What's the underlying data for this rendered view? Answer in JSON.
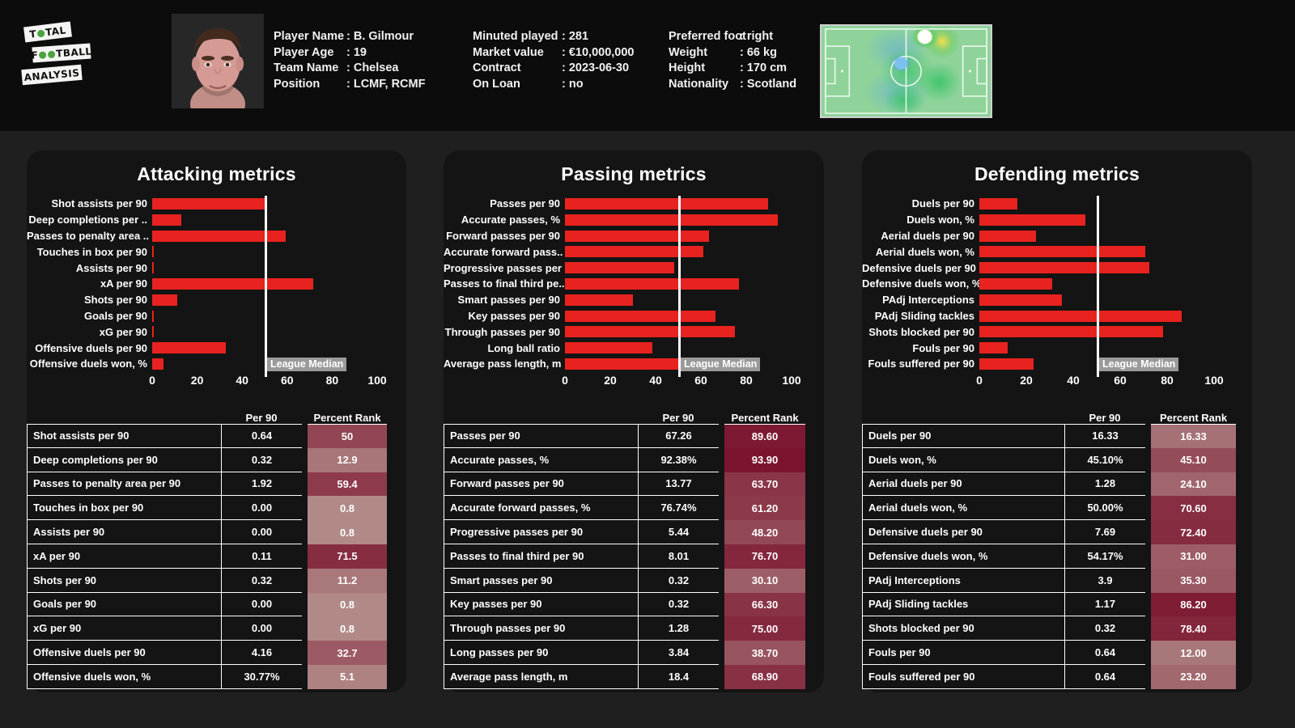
{
  "brand": {
    "line1": "TOTAL",
    "line2": "FOOTBALL",
    "line3": "ANALYSIS",
    "ball_icon": "football-icon"
  },
  "header": {
    "photo_alt": "player-portrait",
    "heatmap_alt": "pitch-heatmap",
    "info_columns": [
      {
        "name": "identity",
        "rows": [
          {
            "key": "Player Name",
            "value": ": B. Gilmour"
          },
          {
            "key": "Player Age",
            "value": ": 19"
          },
          {
            "key": "Team Name",
            "value": ": Chelsea"
          },
          {
            "key": "Position",
            "value": ": LCMF, RCMF"
          }
        ]
      },
      {
        "name": "contract",
        "rows": [
          {
            "key": "Minuted played",
            "value": ": 281"
          },
          {
            "key": "Market value",
            "value": ": €10,000,000"
          },
          {
            "key": "Contract",
            "value": ": 2023-06-30"
          },
          {
            "key": "On Loan",
            "value": ": no"
          }
        ]
      },
      {
        "name": "physical",
        "rows": [
          {
            "key": "Preferred foot",
            "value": ": right"
          },
          {
            "key": "Weight",
            "value": ": 66 kg"
          },
          {
            "key": "Height",
            "value": ": 170 cm"
          },
          {
            "key": "Nationality",
            "value": ": Scotland"
          }
        ]
      }
    ]
  },
  "colors": {
    "bar_red": "#e8221f",
    "median_line": "#ffffff",
    "median_tag_bg": "#9a9a9a",
    "panel_bg": "#141414",
    "page_bg": "#1f1f1f",
    "header_bg": "#0c0c0c"
  },
  "table_headers": {
    "per90": "Per 90",
    "rank": "Percent Rank"
  },
  "median_label": "League Median",
  "chart_data": [
    {
      "type": "bar",
      "title": "Attacking metrics",
      "orientation": "horizontal",
      "xlabel": "",
      "ylabel": "",
      "xlim": [
        0,
        100
      ],
      "xticks": [
        0,
        20,
        40,
        60,
        80,
        100
      ],
      "grid": false,
      "legend": "none",
      "median_value": 50,
      "categories": [
        "Shot assists per 90",
        "Deep completions per ..",
        "Passes to penalty area ..",
        "Touches in box per 90",
        "Assists per 90",
        "xA per 90",
        "Shots per 90",
        "Goals per 90",
        "xG per 90",
        "Offensive duels per 90",
        "Offensive duels won, %"
      ],
      "values": [
        50,
        12.9,
        59.4,
        0.8,
        0.8,
        71.5,
        11.2,
        0.8,
        0.8,
        32.7,
        5.1
      ]
    },
    {
      "type": "bar",
      "title": "Passing metrics",
      "orientation": "horizontal",
      "xlabel": "",
      "ylabel": "",
      "xlim": [
        0,
        100
      ],
      "xticks": [
        0,
        20,
        40,
        60,
        80,
        100
      ],
      "grid": false,
      "legend": "none",
      "median_value": 50,
      "categories": [
        "Passes per 90",
        "Accurate passes, %",
        "Forward passes per 90",
        "Accurate forward pass..",
        "Progressive passes per ..",
        "Passes to final third pe..",
        "Smart passes per 90",
        "Key passes per 90",
        "Through passes per 90",
        "Long ball ratio",
        "Average pass length, m"
      ],
      "values": [
        89.6,
        93.9,
        63.7,
        61.2,
        48.2,
        76.7,
        30.1,
        66.3,
        75.0,
        38.7,
        68.9
      ]
    },
    {
      "type": "bar",
      "title": "Defending metrics",
      "orientation": "horizontal",
      "xlabel": "",
      "ylabel": "",
      "xlim": [
        0,
        100
      ],
      "xticks": [
        0,
        20,
        40,
        60,
        80,
        100
      ],
      "grid": false,
      "legend": "none",
      "median_value": 50,
      "categories": [
        "Duels per 90",
        "Duels won, %",
        "Aerial duels per 90",
        "Aerial duels won, %",
        "Defensive duels per 90",
        "Defensive duels won, %",
        "PAdj Interceptions",
        "PAdj Sliding tackles",
        "Shots blocked per 90",
        "Fouls per 90",
        "Fouls suffered per 90"
      ],
      "values": [
        16.33,
        45.1,
        24.1,
        70.6,
        72.4,
        31.0,
        35.3,
        86.2,
        78.4,
        12.0,
        23.2
      ]
    }
  ],
  "tables": [
    {
      "name": "attacking-table",
      "rows": [
        {
          "metric": "Shot assists per 90",
          "per90": "0.64",
          "rank": "50",
          "rank_value": 50
        },
        {
          "metric": "Deep completions per 90",
          "per90": "0.32",
          "rank": "12.9",
          "rank_value": 12.9
        },
        {
          "metric": "Passes to penalty area per 90",
          "per90": "1.92",
          "rank": "59.4",
          "rank_value": 59.4
        },
        {
          "metric": "Touches in box per 90",
          "per90": "0.00",
          "rank": "0.8",
          "rank_value": 0.8
        },
        {
          "metric": "Assists per 90",
          "per90": "0.00",
          "rank": "0.8",
          "rank_value": 0.8
        },
        {
          "metric": "xA per 90",
          "per90": "0.11",
          "rank": "71.5",
          "rank_value": 71.5
        },
        {
          "metric": "Shots per 90",
          "per90": "0.32",
          "rank": "11.2",
          "rank_value": 11.2
        },
        {
          "metric": "Goals per 90",
          "per90": "0.00",
          "rank": "0.8",
          "rank_value": 0.8
        },
        {
          "metric": "xG per 90",
          "per90": "0.00",
          "rank": "0.8",
          "rank_value": 0.8
        },
        {
          "metric": "Offensive duels per 90",
          "per90": "4.16",
          "rank": "32.7",
          "rank_value": 32.7
        },
        {
          "metric": "Offensive duels won, %",
          "per90": "30.77%",
          "rank": "5.1",
          "rank_value": 5.1
        }
      ]
    },
    {
      "name": "passing-table",
      "rows": [
        {
          "metric": "Passes per 90",
          "per90": "67.26",
          "rank": "89.60",
          "rank_value": 89.6
        },
        {
          "metric": "Accurate passes, %",
          "per90": "92.38%",
          "rank": "93.90",
          "rank_value": 93.9
        },
        {
          "metric": "Forward passes per 90",
          "per90": "13.77",
          "rank": "63.70",
          "rank_value": 63.7
        },
        {
          "metric": "Accurate forward passes, %",
          "per90": "76.74%",
          "rank": "61.20",
          "rank_value": 61.2
        },
        {
          "metric": "Progressive passes per 90",
          "per90": "5.44",
          "rank": "48.20",
          "rank_value": 48.2
        },
        {
          "metric": "Passes to final third per 90",
          "per90": "8.01",
          "rank": "76.70",
          "rank_value": 76.7
        },
        {
          "metric": "Smart passes per 90",
          "per90": "0.32",
          "rank": "30.10",
          "rank_value": 30.1
        },
        {
          "metric": "Key passes per 90",
          "per90": "0.32",
          "rank": "66.30",
          "rank_value": 66.3
        },
        {
          "metric": "Through passes per 90",
          "per90": "1.28",
          "rank": "75.00",
          "rank_value": 75.0
        },
        {
          "metric": "Long passes per 90",
          "per90": "3.84",
          "rank": "38.70",
          "rank_value": 38.7
        },
        {
          "metric": "Average pass length, m",
          "per90": "18.4",
          "rank": "68.90",
          "rank_value": 68.9
        }
      ]
    },
    {
      "name": "defending-table",
      "rows": [
        {
          "metric": "Duels per 90",
          "per90": "16.33",
          "rank": "16.33",
          "rank_value": 16.33
        },
        {
          "metric": "Duels won, %",
          "per90": "45.10%",
          "rank": "45.10",
          "rank_value": 45.1
        },
        {
          "metric": "Aerial duels per 90",
          "per90": "1.28",
          "rank": "24.10",
          "rank_value": 24.1
        },
        {
          "metric": "Aerial duels won, %",
          "per90": "50.00%",
          "rank": "70.60",
          "rank_value": 70.6
        },
        {
          "metric": "Defensive duels per 90",
          "per90": "7.69",
          "rank": "72.40",
          "rank_value": 72.4
        },
        {
          "metric": "Defensive duels won, %",
          "per90": "54.17%",
          "rank": "31.00",
          "rank_value": 31.0
        },
        {
          "metric": "PAdj Interceptions",
          "per90": "3.9",
          "rank": "35.30",
          "rank_value": 35.3
        },
        {
          "metric": "PAdj Sliding tackles",
          "per90": "1.17",
          "rank": "86.20",
          "rank_value": 86.2
        },
        {
          "metric": "Shots blocked per 90",
          "per90": "0.32",
          "rank": "78.40",
          "rank_value": 78.4
        },
        {
          "metric": "Fouls per 90",
          "per90": "0.64",
          "rank": "12.00",
          "rank_value": 12.0
        },
        {
          "metric": "Fouls suffered per 90",
          "per90": "0.64",
          "rank": "23.20",
          "rank_value": 23.2
        }
      ]
    }
  ],
  "layout": {
    "label_widths": [
      155,
      150,
      145
    ],
    "track_widths": [
      278,
      280,
      290
    ],
    "metric_widths": [
      240,
      240,
      250
    ],
    "v90_widths": [
      100,
      100,
      100
    ],
    "rank_widths": [
      98,
      100,
      105
    ]
  }
}
